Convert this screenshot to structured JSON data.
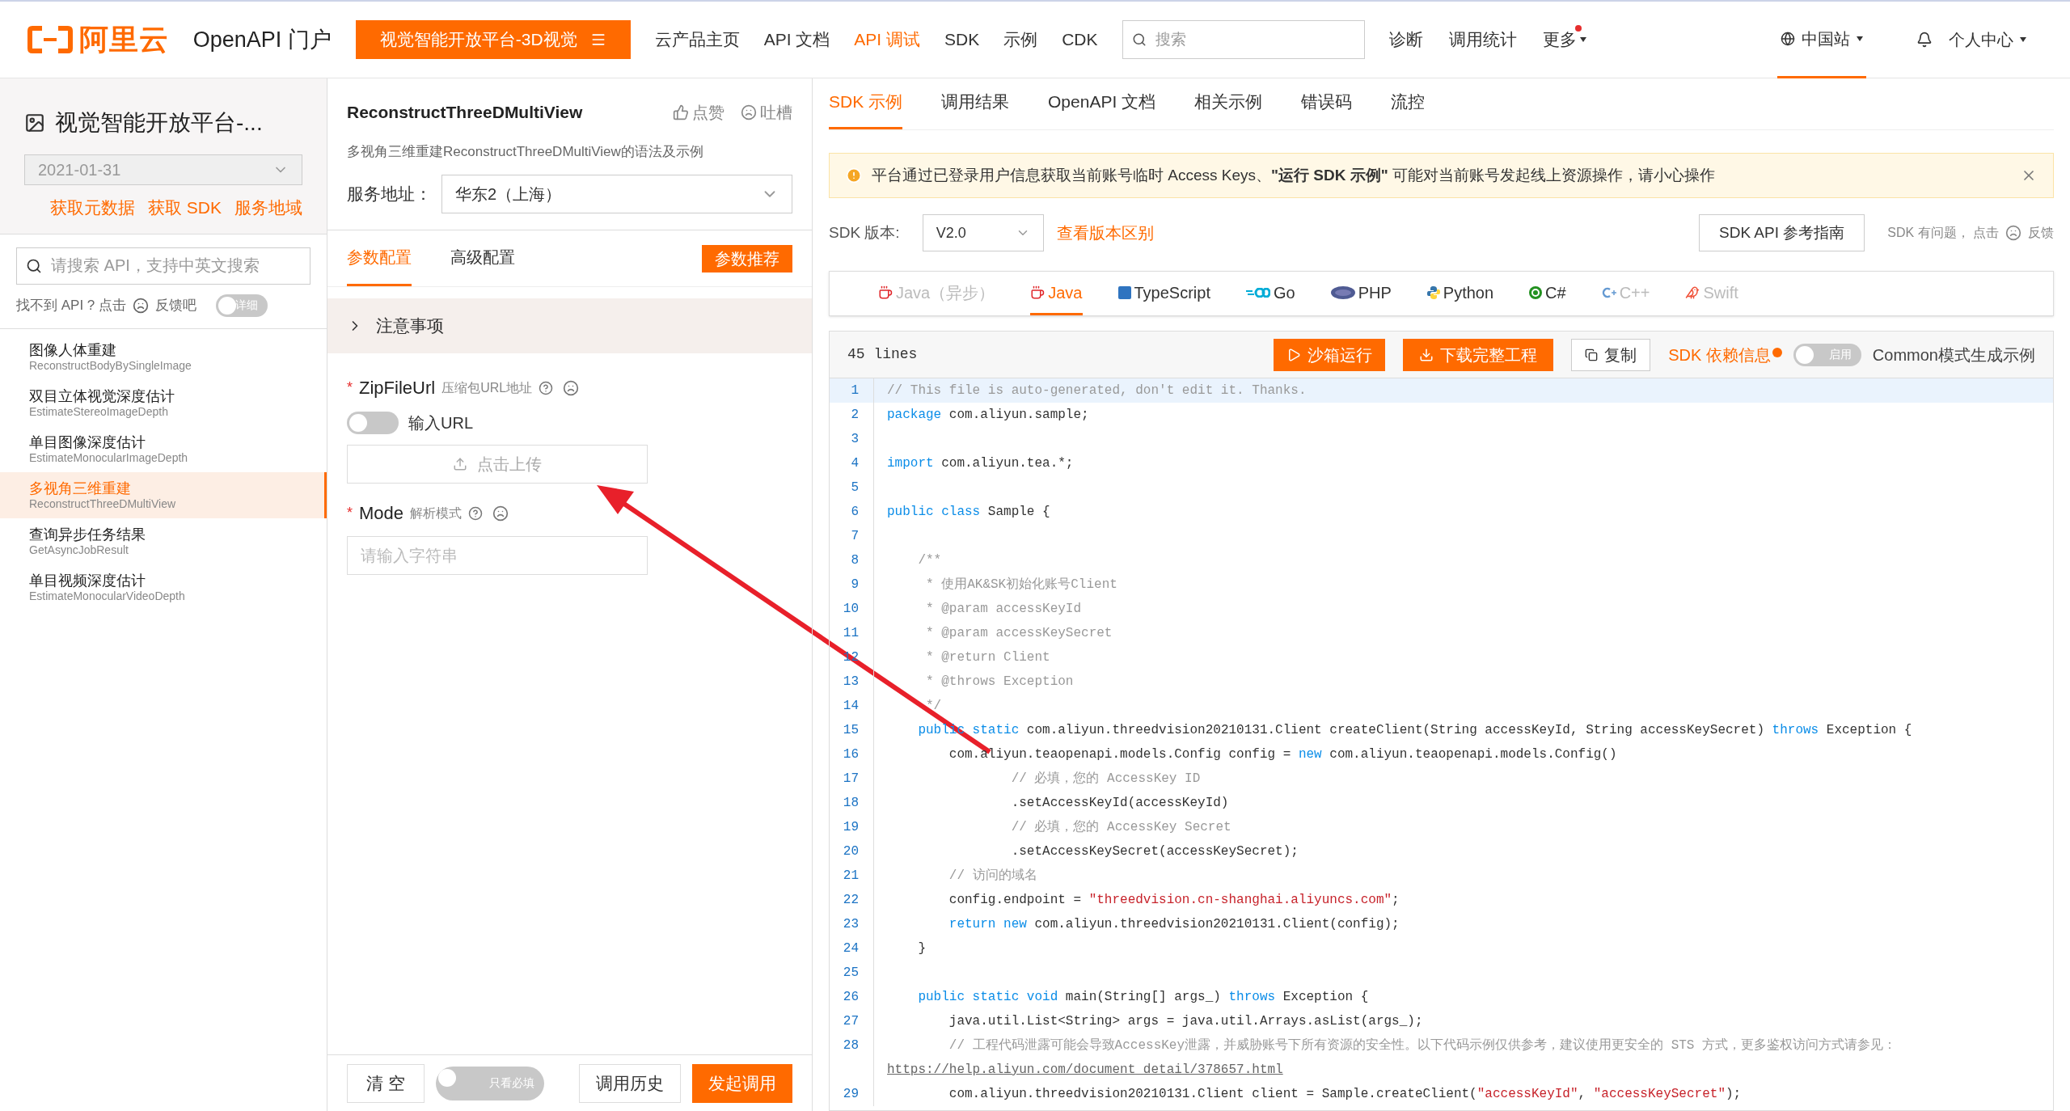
{
  "topbar": {
    "logo_text": "阿里云",
    "portal": "OpenAPI 门户",
    "product_button": "视觉智能开放平台-3D视觉",
    "nav": [
      {
        "label": "云产品主页",
        "selected": false
      },
      {
        "label": "API 文档",
        "selected": false
      },
      {
        "label": "API 调试",
        "selected": true
      },
      {
        "label": "SDK",
        "selected": false
      },
      {
        "label": "示例",
        "selected": false
      },
      {
        "label": "CDK",
        "selected": false
      }
    ],
    "search": {
      "placeholder": "搜索"
    },
    "links": [
      {
        "label": "诊断",
        "badge": false,
        "caret": false
      },
      {
        "label": "调用统计",
        "badge": false,
        "caret": false
      },
      {
        "label": "更多",
        "badge": true,
        "caret": true
      }
    ],
    "region": "中国站",
    "user": "个人中心"
  },
  "sidebar": {
    "title": "视觉智能开放平台-...",
    "version": "2021-01-31",
    "links": [
      "获取元数据",
      "获取 SDK",
      "服务地域"
    ],
    "search": {
      "placeholder": "请搜索 API，支持中英文搜索"
    },
    "feedback": {
      "before": "找不到 API ? 点击",
      "after": "反馈吧",
      "toggle": {
        "label": "详细",
        "on": false
      }
    },
    "apis": [
      {
        "name": "图像人体重建",
        "code": "ReconstructBodyBySingleImage",
        "selected": false
      },
      {
        "name": "双目立体视觉深度估计",
        "code": "EstimateStereoImageDepth",
        "selected": false
      },
      {
        "name": "单目图像深度估计",
        "code": "EstimateMonocularImageDepth",
        "selected": false
      },
      {
        "name": "多视角三维重建",
        "code": "ReconstructThreeDMultiView",
        "selected": true
      },
      {
        "name": "查询异步任务结果",
        "code": "GetAsyncJobResult",
        "selected": false
      },
      {
        "name": "单目视频深度估计",
        "code": "EstimateMonocularVideoDepth",
        "selected": false
      }
    ]
  },
  "params_panel": {
    "title": "ReconstructThreeDMultiView",
    "like": "点赞",
    "complain": "吐槽",
    "description": "多视角三维重建ReconstructThreeDMultiView的语法及示例",
    "service": {
      "label": "服务地址：",
      "value": "华东2（上海）"
    },
    "tabs": [
      {
        "label": "参数配置",
        "selected": true
      },
      {
        "label": "高级配置",
        "selected": false
      }
    ],
    "recommend_button": "参数推荐",
    "notice": {
      "label": "注意事项",
      "expanded": false
    },
    "params": [
      {
        "name": "ZipFileUrl",
        "description": "压缩包URL地址",
        "required_mark": "*",
        "kind": "upload",
        "switch": {
          "label": "输入URL",
          "on": false
        },
        "upload_button": "点击上传"
      },
      {
        "name": "Mode",
        "description": "解析模式",
        "required_mark": "*",
        "kind": "text",
        "placeholder": "请输入字符串"
      }
    ],
    "footer": {
      "clear": "清 空",
      "required_only": {
        "label": "只看必填",
        "on": false
      },
      "history": "调用历史",
      "submit": "发起调用"
    }
  },
  "sdk_panel": {
    "tabs": [
      {
        "label": "SDK 示例",
        "selected": true
      },
      {
        "label": "调用结果",
        "selected": false
      },
      {
        "label": "OpenAPI 文档",
        "selected": false
      },
      {
        "label": "相关示例",
        "selected": false
      },
      {
        "label": "错误码",
        "selected": false
      },
      {
        "label": "流控",
        "selected": false
      }
    ],
    "alert": {
      "text": "平台通过已登录用户信息获取当前账号临时 Access Keys、**\"运行 SDK 示例\"** 可能对当前账号发起线上资源操作，请小心操作"
    },
    "version": {
      "label": "SDK 版本:",
      "value": "V2.0",
      "diff_link": "查看版本区别"
    },
    "reference_button": "SDK API 参考指南",
    "feedback": {
      "before": "SDK 有问题， 点击",
      "after": "反馈"
    },
    "languages": [
      {
        "label": "Java（异步）",
        "selected": false,
        "disabled": true
      },
      {
        "label": "Java",
        "selected": true,
        "disabled": false
      },
      {
        "label": "TypeScript",
        "selected": false,
        "disabled": false
      },
      {
        "label": "Go",
        "selected": false,
        "disabled": false
      },
      {
        "label": "PHP",
        "selected": false,
        "disabled": false
      },
      {
        "label": "Python",
        "selected": false,
        "disabled": false
      },
      {
        "label": "C#",
        "selected": false,
        "disabled": false
      },
      {
        "label": "C++",
        "selected": false,
        "disabled": true
      },
      {
        "label": "Swift",
        "selected": false,
        "disabled": true
      }
    ],
    "code_header": {
      "line_count": "45 lines",
      "run": "沙箱运行",
      "download": "下载完整工程",
      "copy": "复制",
      "deps": "SDK 依赖信息",
      "common_toggle": {
        "label": "启用",
        "on": false
      },
      "common_label": "Common模式生成示例"
    },
    "code": [
      {
        "n": "1",
        "highlighted": true,
        "tokens": [
          {
            "kind": "comment",
            "text": "// This file is auto-generated, don't edit it. Thanks."
          }
        ]
      },
      {
        "n": "2",
        "highlighted": false,
        "tokens": [
          {
            "kind": "keyword",
            "text": "package"
          },
          {
            "kind": "plain",
            "text": " com.aliyun.sample;"
          }
        ]
      },
      {
        "n": "3",
        "highlighted": false
      },
      {
        "n": "4",
        "highlighted": false,
        "tokens": [
          {
            "kind": "keyword",
            "text": "import"
          },
          {
            "kind": "plain",
            "text": " com.aliyun.tea.*;"
          }
        ]
      },
      {
        "n": "5",
        "highlighted": false
      },
      {
        "n": "6",
        "highlighted": false,
        "tokens": [
          {
            "kind": "keyword",
            "text": "public class"
          },
          {
            "kind": "plain",
            "text": " Sample {"
          }
        ]
      },
      {
        "n": "7",
        "highlighted": false
      },
      {
        "n": "8",
        "highlighted": false,
        "tokens": [
          {
            "kind": "comment",
            "text": "    /**"
          }
        ]
      },
      {
        "n": "9",
        "highlighted": false,
        "tokens": [
          {
            "kind": "comment",
            "text": "     * 使用AK&SK初始化账号Client"
          }
        ]
      },
      {
        "n": "10",
        "highlighted": false,
        "tokens": [
          {
            "kind": "comment",
            "text": "     * @param accessKeyId"
          }
        ]
      },
      {
        "n": "11",
        "highlighted": false,
        "tokens": [
          {
            "kind": "comment",
            "text": "     * @param accessKeySecret"
          }
        ]
      },
      {
        "n": "12",
        "highlighted": false,
        "tokens": [
          {
            "kind": "comment",
            "text": "     * @return Client"
          }
        ]
      },
      {
        "n": "13",
        "highlighted": false,
        "tokens": [
          {
            "kind": "comment",
            "text": "     * @throws Exception"
          }
        ]
      },
      {
        "n": "14",
        "highlighted": false,
        "tokens": [
          {
            "kind": "comment",
            "text": "     */"
          }
        ]
      },
      {
        "n": "15",
        "highlighted": false,
        "tokens": [
          {
            "kind": "keyword",
            "text": "    public static"
          },
          {
            "kind": "plain",
            "text": " com.aliyun.threedvision20210131.Client createClient(String accessKeyId, String accessKeySecret) "
          },
          {
            "kind": "keyword",
            "text": "throws"
          },
          {
            "kind": "plain",
            "text": " Exception {"
          }
        ]
      },
      {
        "n": "16",
        "highlighted": false,
        "tokens": [
          {
            "kind": "plain",
            "text": "        com.aliyun.teaopenapi.models.Config config = "
          },
          {
            "kind": "keyword",
            "text": "new"
          },
          {
            "kind": "plain",
            "text": " com.aliyun.teaopenapi.models.Config()"
          }
        ]
      },
      {
        "n": "17",
        "highlighted": false,
        "tokens": [
          {
            "kind": "comment",
            "text": "                // 必填，您的 AccessKey ID"
          }
        ]
      },
      {
        "n": "18",
        "highlighted": false,
        "tokens": [
          {
            "kind": "plain",
            "text": "                .setAccessKeyId(accessKeyId)"
          }
        ]
      },
      {
        "n": "19",
        "highlighted": false,
        "tokens": [
          {
            "kind": "comment",
            "text": "                // 必填，您的 AccessKey Secret"
          }
        ]
      },
      {
        "n": "20",
        "highlighted": false,
        "tokens": [
          {
            "kind": "plain",
            "text": "                .setAccessKeySecret(accessKeySecret);"
          }
        ]
      },
      {
        "n": "21",
        "highlighted": false,
        "tokens": [
          {
            "kind": "comment",
            "text": "        // 访问的域名"
          }
        ]
      },
      {
        "n": "22",
        "highlighted": false,
        "tokens": [
          {
            "kind": "plain",
            "text": "        config.endpoint = "
          },
          {
            "kind": "string",
            "text": "\"threedvision.cn-shanghai.aliyuncs.com\""
          },
          {
            "kind": "plain",
            "text": ";"
          }
        ]
      },
      {
        "n": "23",
        "highlighted": false,
        "tokens": [
          {
            "kind": "keyword",
            "text": "        return new"
          },
          {
            "kind": "plain",
            "text": " com.aliyun.threedvision20210131.Client(config);"
          }
        ]
      },
      {
        "n": "24",
        "highlighted": false,
        "tokens": [
          {
            "kind": "plain",
            "text": "    }"
          }
        ]
      },
      {
        "n": "25",
        "highlighted": false
      },
      {
        "n": "26",
        "highlighted": false,
        "tokens": [
          {
            "kind": "keyword",
            "text": "    public static void"
          },
          {
            "kind": "plain",
            "text": " main(String[] args_) "
          },
          {
            "kind": "keyword",
            "text": "throws"
          },
          {
            "kind": "plain",
            "text": " Exception {"
          }
        ]
      },
      {
        "n": "27",
        "highlighted": false,
        "tokens": [
          {
            "kind": "plain",
            "text": "        java.util.List<String> args = java.util.Arrays.asList(args_);"
          }
        ]
      },
      {
        "n": "28",
        "highlighted": false,
        "tokens": [
          {
            "kind": "comment",
            "text": "        // 工程代码泄露可能会导致AccessKey泄露，并威胁账号下所有资源的安全性。以下代码示例仅供参考，建议使用更安全的 STS 方式，更多鉴权访问方式请参见："
          }
        ],
        "continuation": "https://help.aliyun.com/document_detail/378657.html"
      },
      {
        "n": "29",
        "highlighted": false,
        "tokens": [
          {
            "kind": "plain",
            "text": "        com.aliyun.threedvision20210131.Client client = Sample.createClient("
          },
          {
            "kind": "string",
            "text": "\"accessKeyId\""
          },
          {
            "kind": "plain",
            "text": ", "
          },
          {
            "kind": "string",
            "text": "\"accessKeySecret\""
          },
          {
            "kind": "plain",
            "text": ");"
          }
        ]
      }
    ]
  }
}
